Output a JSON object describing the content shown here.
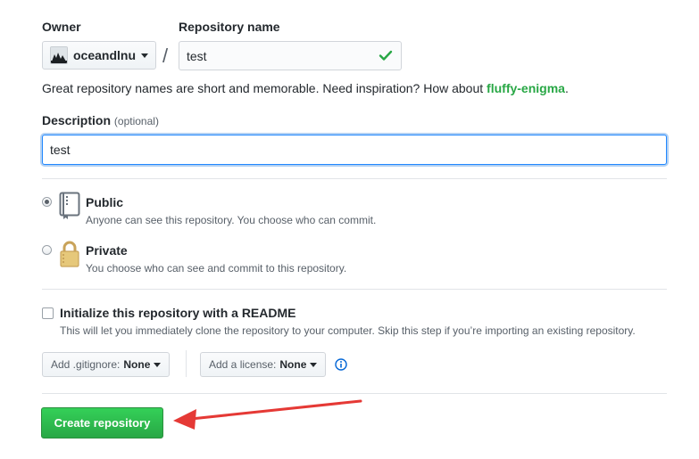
{
  "owner": {
    "label": "Owner",
    "value": "oceandlnu"
  },
  "repo": {
    "label": "Repository name",
    "value": "test",
    "valid": true
  },
  "hint": {
    "text": "Great repository names are short and memorable. Need inspiration? How about ",
    "suggestion": "fluffy-enigma",
    "end": "."
  },
  "description": {
    "label": "Description",
    "optional": "(optional)",
    "value": "test"
  },
  "visibility": {
    "public": {
      "title": "Public",
      "desc": "Anyone can see this repository. You choose who can commit.",
      "selected": true
    },
    "private": {
      "title": "Private",
      "desc": "You choose who can see and commit to this repository.",
      "selected": false
    }
  },
  "readme": {
    "title": "Initialize this repository with a README",
    "desc": "This will let you immediately clone the repository to your computer. Skip this step if you’re importing an existing repository.",
    "checked": false
  },
  "gitignore": {
    "prefix": "Add .gitignore:",
    "value": "None"
  },
  "license": {
    "prefix": "Add a license:",
    "value": "None"
  },
  "create_button": "Create repository",
  "colors": {
    "accent_green": "#28a745",
    "focus_blue": "#2188ff",
    "annotation_red": "#e53935"
  },
  "icons": {
    "check": "check-icon",
    "repo": "repo-icon",
    "lock": "lock-icon",
    "caret": "caret-down-icon",
    "info": "info-icon"
  }
}
